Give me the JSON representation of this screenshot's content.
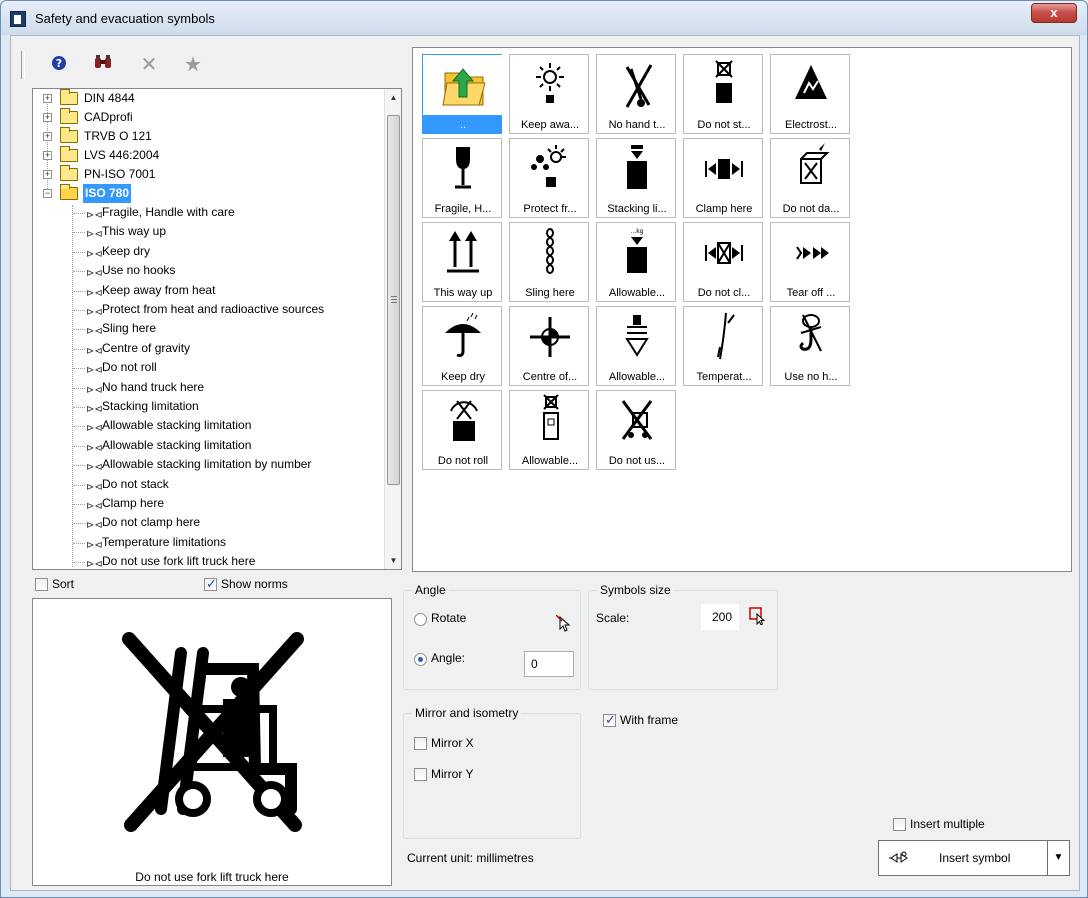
{
  "window": {
    "title": "Safety and evacuation symbols",
    "close_label": "x"
  },
  "toolbar": {
    "help_icon": "help-icon",
    "search_icon": "binoculars-icon",
    "delete_icon": "delete-icon",
    "favorite_icon": "star-icon"
  },
  "tree": {
    "folders": [
      {
        "label": "DIN 4844"
      },
      {
        "label": "CADprofi"
      },
      {
        "label": "TRVB O 121"
      },
      {
        "label": "LVS 446:2004"
      },
      {
        "label": "PN-ISO 7001"
      },
      {
        "label": "ISO 780",
        "selected": true
      }
    ],
    "items": [
      {
        "label": "Fragile, Handle with care"
      },
      {
        "label": "This way up"
      },
      {
        "label": "Keep dry"
      },
      {
        "label": "Use no hooks"
      },
      {
        "label": "Keep away from heat"
      },
      {
        "label": "Protect from heat and radioactive sources"
      },
      {
        "label": "Sling here"
      },
      {
        "label": "Centre of gravity"
      },
      {
        "label": "Do not roll"
      },
      {
        "label": "No hand truck here"
      },
      {
        "label": "Stacking limitation"
      },
      {
        "label": "Allowable stacking limitation"
      },
      {
        "label": "Allowable stacking limitation"
      },
      {
        "label": "Allowable stacking limitation by number"
      },
      {
        "label": "Do not stack"
      },
      {
        "label": "Clamp here"
      },
      {
        "label": "Do not clamp here"
      },
      {
        "label": "Temperature limitations"
      },
      {
        "label": "Do not use fork lift truck here"
      }
    ]
  },
  "options": {
    "sort_label": "Sort",
    "sort_checked": false,
    "show_norms_label": "Show norms",
    "show_norms_checked": true
  },
  "preview": {
    "caption": "Do not use fork lift truck here"
  },
  "symbols": [
    {
      "label": "..",
      "icon": "folder-up-icon",
      "selected": true
    },
    {
      "label": "Keep awa...",
      "icon": "keep-away-heat-icon"
    },
    {
      "label": "No hand t...",
      "icon": "no-hand-truck-icon"
    },
    {
      "label": "Do not st...",
      "icon": "do-not-stack-icon"
    },
    {
      "label": "Electrost...",
      "icon": "electrostatic-icon"
    },
    {
      "label": "Fragile, H...",
      "icon": "fragile-icon"
    },
    {
      "label": "Protect fr...",
      "icon": "protect-heat-radio-icon"
    },
    {
      "label": "Stacking li...",
      "icon": "stacking-limit-icon"
    },
    {
      "label": "Clamp here",
      "icon": "clamp-here-icon"
    },
    {
      "label": "Do not da...",
      "icon": "do-not-damage-icon"
    },
    {
      "label": "This way up",
      "icon": "this-way-up-icon"
    },
    {
      "label": "Sling here",
      "icon": "sling-here-icon"
    },
    {
      "label": "Allowable...",
      "icon": "allowable-stacking-icon"
    },
    {
      "label": "Do not cl...",
      "icon": "do-not-clamp-icon"
    },
    {
      "label": "Tear off ...",
      "icon": "tear-off-icon"
    },
    {
      "label": "Keep dry",
      "icon": "keep-dry-icon"
    },
    {
      "label": "Centre of...",
      "icon": "centre-gravity-icon"
    },
    {
      "label": "Allowable...",
      "icon": "allowable-stacking-2-icon"
    },
    {
      "label": "Temperat...",
      "icon": "temperature-icon"
    },
    {
      "label": "Use no h...",
      "icon": "use-no-hooks-icon"
    },
    {
      "label": "Do not roll",
      "icon": "do-not-roll-icon"
    },
    {
      "label": "Allowable...",
      "icon": "allowable-stacking-number-icon"
    },
    {
      "label": "Do not us...",
      "icon": "no-fork-lift-icon"
    }
  ],
  "angle": {
    "title": "Angle",
    "rotate_label": "Rotate",
    "angle_label": "Angle:",
    "angle_value": "0",
    "mode": "angle"
  },
  "size": {
    "title": "Symbols size",
    "scale_label": "Scale:",
    "scale_value": "200"
  },
  "mirror": {
    "title": "Mirror and isometry",
    "mirror_x_label": "Mirror X",
    "mirror_y_label": "Mirror Y",
    "mirror_x": false,
    "mirror_y": false
  },
  "frame": {
    "label": "With frame",
    "checked": true
  },
  "status": {
    "unit_text": "Current unit: millimetres"
  },
  "insert": {
    "multiple_label": "Insert multiple",
    "multiple_checked": false,
    "button_label": "Insert symbol",
    "dropdown_glyph": "▼"
  }
}
